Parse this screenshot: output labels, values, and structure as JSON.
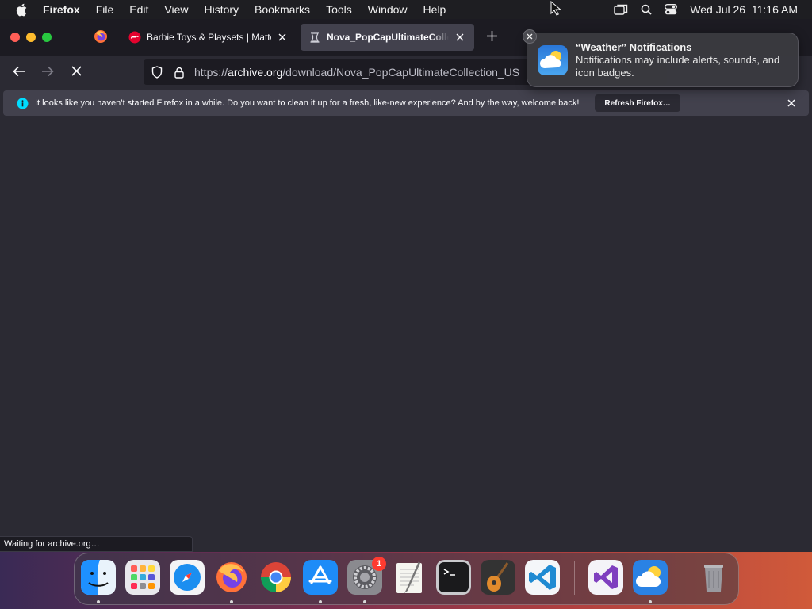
{
  "menubar": {
    "app_name": "Firefox",
    "items": [
      "File",
      "Edit",
      "View",
      "History",
      "Bookmarks",
      "Tools",
      "Window",
      "Help"
    ],
    "clock": "Wed Jul 26  11:16 AM"
  },
  "tabs": [
    {
      "title": "Barbie Toys & Playsets | Mattel",
      "favicon": "mattel-logo-icon",
      "active": false
    },
    {
      "title": "Nova_PopCapUltimateCollection_US",
      "favicon": "archive-org-icon",
      "active": true
    }
  ],
  "urlbar": {
    "url_prefix": "https://",
    "url_domain": "archive.org",
    "url_path": "/download/Nova_PopCapUltimateCollection_US"
  },
  "infobar": {
    "message": "It looks like you haven’t started Firefox in a while. Do you want to clean it up for a fresh, like-new experience? And by the way, welcome back!",
    "button_label": "Refresh Firefox…"
  },
  "statusbar": {
    "text": "Waiting for archive.org…"
  },
  "notification": {
    "title": "“Weather” Notifications",
    "body": "Notifications may include alerts, sounds, and icon badges."
  },
  "dock": {
    "apps": [
      "Finder",
      "Launchpad",
      "Safari",
      "Firefox",
      "Google Chrome",
      "App Store",
      "System Preferences",
      "TextEdit",
      "Terminal",
      "GarageBand",
      "Visual Studio Code",
      "Visual Studio",
      "Weather",
      "Trash"
    ],
    "system_preferences_badge": "1"
  },
  "colors": {
    "toolbar": "#2b2a33",
    "tabstrip": "#1c1b22",
    "infobar": "#42414d",
    "accent_blue": "#00ddff"
  }
}
